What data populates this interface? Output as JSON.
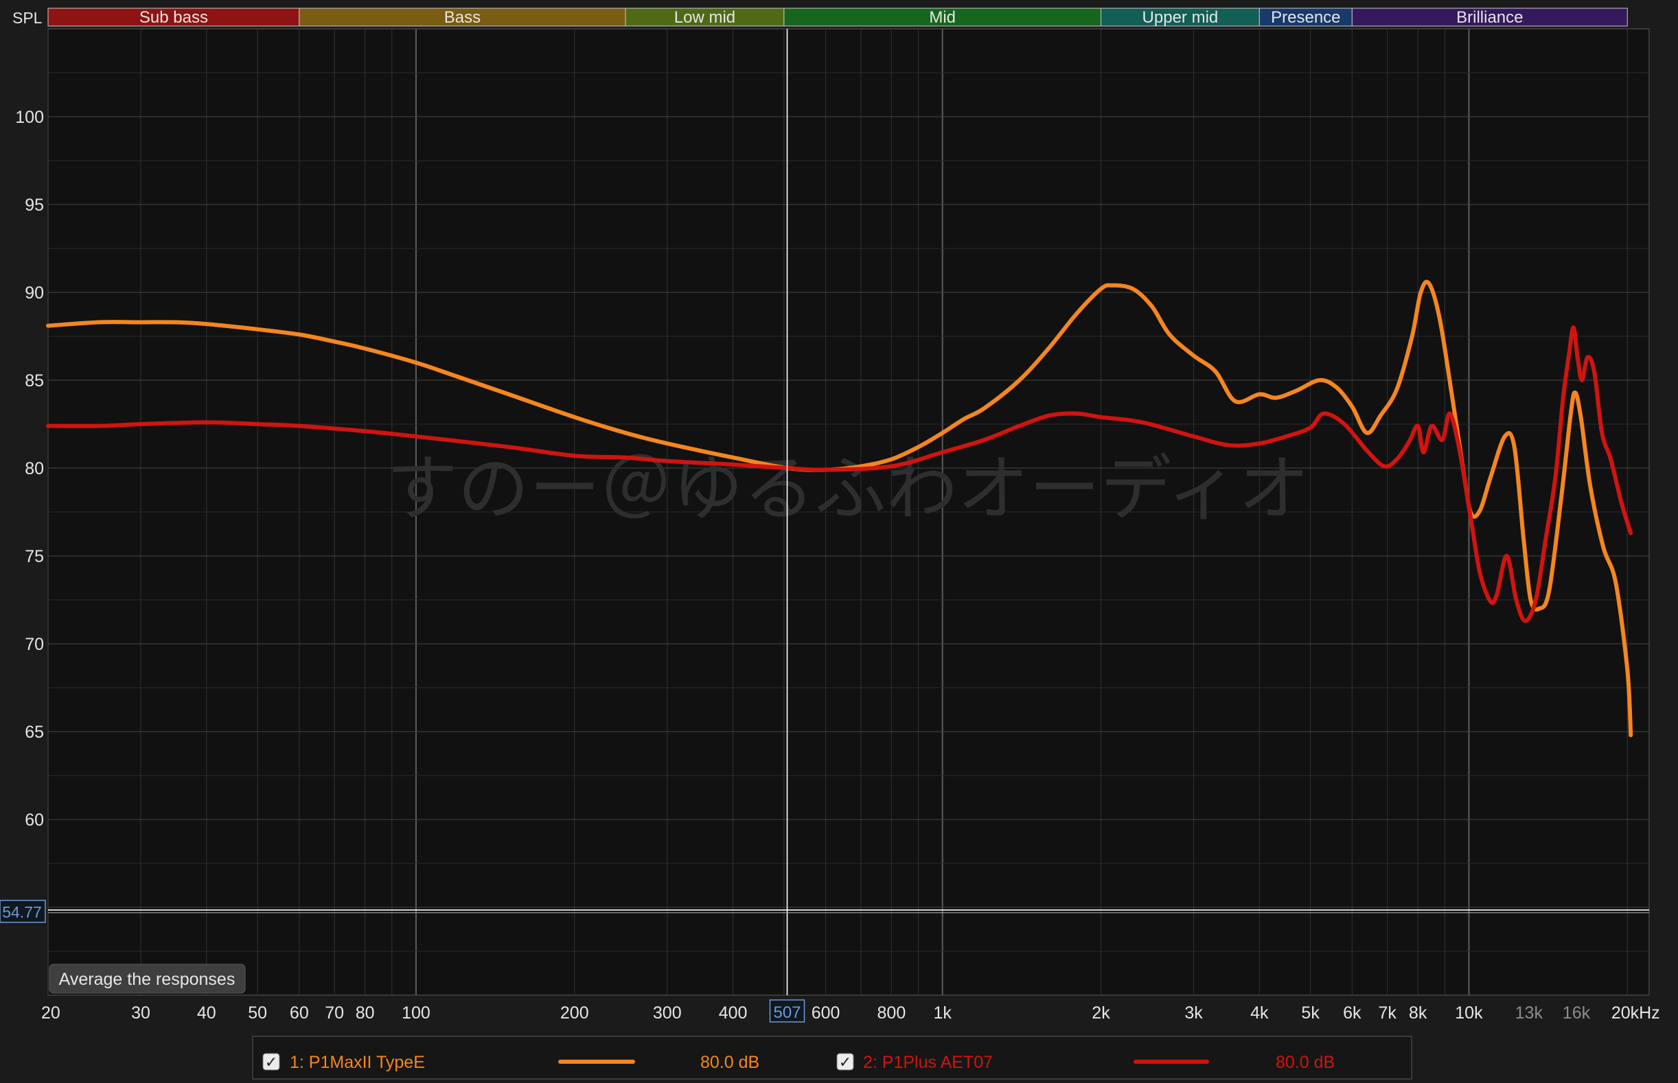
{
  "app": {
    "spl_label": "SPL",
    "cursor_freq_label": "507",
    "cursor_level_label": "54.77",
    "average_button_label": "Average the responses",
    "watermark": "すのー＠ゆるふわオーディオ"
  },
  "colors": {
    "background": "#1b1b1b",
    "plot_background": "#111111",
    "grid_major": "#555555",
    "grid_minor": "#333333",
    "axis_text": "#e6e6e6",
    "cursor": "#ffffff",
    "cursor_label": "#6a9bd8",
    "series_1": "#f5861f",
    "series_2": "#d0140f"
  },
  "chart_data": {
    "type": "line",
    "x_scale": "log",
    "xlim": [
      20,
      22000
    ],
    "ylim": [
      50,
      105
    ],
    "grid": true,
    "legend": "bottom",
    "x_ticks": [
      {
        "value": 20,
        "label": "20"
      },
      {
        "value": 30,
        "label": "30"
      },
      {
        "value": 40,
        "label": "40"
      },
      {
        "value": 50,
        "label": "50"
      },
      {
        "value": 60,
        "label": "60"
      },
      {
        "value": 70,
        "label": "70"
      },
      {
        "value": 80,
        "label": "80"
      },
      {
        "value": 100,
        "label": "100"
      },
      {
        "value": 200,
        "label": "200"
      },
      {
        "value": 300,
        "label": "300"
      },
      {
        "value": 400,
        "label": "400"
      },
      {
        "value": 600,
        "label": "600"
      },
      {
        "value": 800,
        "label": "800"
      },
      {
        "value": 1000,
        "label": "1k"
      },
      {
        "value": 2000,
        "label": "2k"
      },
      {
        "value": 3000,
        "label": "3k"
      },
      {
        "value": 4000,
        "label": "4k"
      },
      {
        "value": 5000,
        "label": "5k"
      },
      {
        "value": 6000,
        "label": "6k"
      },
      {
        "value": 7000,
        "label": "7k"
      },
      {
        "value": 8000,
        "label": "8k"
      },
      {
        "value": 10000,
        "label": "10k"
      },
      {
        "value": 13000,
        "label": "13k",
        "dim": true
      },
      {
        "value": 16000,
        "label": "16k",
        "dim": true
      },
      {
        "value": 20000,
        "label": "20kHz"
      }
    ],
    "y_ticks": [
      60,
      65,
      70,
      75,
      80,
      85,
      90,
      95,
      100
    ],
    "bands": [
      {
        "name": "Sub bass",
        "from": 20,
        "to": 60,
        "color": "#8e1414"
      },
      {
        "name": "Bass",
        "from": 60,
        "to": 250,
        "color": "#7a5c12"
      },
      {
        "name": "Low mid",
        "from": 250,
        "to": 500,
        "color": "#4f6a16"
      },
      {
        "name": "Mid",
        "from": 500,
        "to": 2000,
        "color": "#16661d"
      },
      {
        "name": "Upper mid",
        "from": 2000,
        "to": 4000,
        "color": "#135e55"
      },
      {
        "name": "Presence",
        "from": 4000,
        "to": 6000,
        "color": "#17396b"
      },
      {
        "name": "Brilliance",
        "from": 6000,
        "to": 20000,
        "color": "#341a5c"
      }
    ],
    "cursor": {
      "x": 507,
      "y": 54.77
    },
    "series": [
      {
        "name": "1: P1MaxII TypeE",
        "level": "80.0 dB",
        "color": "#f5861f",
        "points": [
          [
            20,
            88.1
          ],
          [
            25,
            88.3
          ],
          [
            30,
            88.3
          ],
          [
            35,
            88.3
          ],
          [
            40,
            88.2
          ],
          [
            50,
            87.9
          ],
          [
            60,
            87.6
          ],
          [
            70,
            87.2
          ],
          [
            80,
            86.8
          ],
          [
            100,
            86.0
          ],
          [
            120,
            85.2
          ],
          [
            150,
            84.2
          ],
          [
            200,
            82.9
          ],
          [
            250,
            82.0
          ],
          [
            300,
            81.4
          ],
          [
            400,
            80.6
          ],
          [
            507,
            80.0
          ],
          [
            600,
            79.9
          ],
          [
            700,
            80.1
          ],
          [
            800,
            80.5
          ],
          [
            900,
            81.2
          ],
          [
            1000,
            82.0
          ],
          [
            1100,
            82.8
          ],
          [
            1200,
            83.4
          ],
          [
            1400,
            85.0
          ],
          [
            1600,
            86.9
          ],
          [
            1800,
            88.8
          ],
          [
            2000,
            90.2
          ],
          [
            2100,
            90.4
          ],
          [
            2300,
            90.2
          ],
          [
            2500,
            89.2
          ],
          [
            2700,
            87.6
          ],
          [
            3000,
            86.4
          ],
          [
            3300,
            85.5
          ],
          [
            3600,
            83.8
          ],
          [
            4000,
            84.2
          ],
          [
            4300,
            84.0
          ],
          [
            4700,
            84.4
          ],
          [
            5200,
            85.0
          ],
          [
            5600,
            84.6
          ],
          [
            6000,
            83.5
          ],
          [
            6400,
            82.0
          ],
          [
            6800,
            83.0
          ],
          [
            7300,
            84.5
          ],
          [
            7800,
            87.5
          ],
          [
            8100,
            90.0
          ],
          [
            8400,
            90.5
          ],
          [
            8800,
            88.5
          ],
          [
            9300,
            84.0
          ],
          [
            9800,
            79.5
          ],
          [
            10100,
            77.4
          ],
          [
            10500,
            77.6
          ],
          [
            11000,
            79.5
          ],
          [
            11700,
            81.8
          ],
          [
            12200,
            81.2
          ],
          [
            12700,
            76.0
          ],
          [
            13100,
            72.5
          ],
          [
            13600,
            72.0
          ],
          [
            14200,
            73.0
          ],
          [
            15000,
            78.5
          ],
          [
            15600,
            83.0
          ],
          [
            15900,
            84.3
          ],
          [
            16300,
            83.0
          ],
          [
            17000,
            79.0
          ],
          [
            18000,
            75.5
          ],
          [
            19000,
            73.5
          ],
          [
            20000,
            68.5
          ],
          [
            20300,
            64.8
          ]
        ]
      },
      {
        "name": "2: P1Plus AET07",
        "level": "80.0 dB",
        "color": "#d0140f",
        "points": [
          [
            20,
            82.4
          ],
          [
            25,
            82.4
          ],
          [
            30,
            82.5
          ],
          [
            40,
            82.6
          ],
          [
            50,
            82.5
          ],
          [
            60,
            82.4
          ],
          [
            80,
            82.1
          ],
          [
            100,
            81.8
          ],
          [
            150,
            81.2
          ],
          [
            200,
            80.7
          ],
          [
            250,
            80.6
          ],
          [
            300,
            80.4
          ],
          [
            400,
            80.2
          ],
          [
            507,
            80.0
          ],
          [
            600,
            79.9
          ],
          [
            800,
            80.1
          ],
          [
            1000,
            80.9
          ],
          [
            1200,
            81.6
          ],
          [
            1400,
            82.4
          ],
          [
            1600,
            83.0
          ],
          [
            1800,
            83.1
          ],
          [
            2000,
            82.9
          ],
          [
            2400,
            82.6
          ],
          [
            3000,
            81.8
          ],
          [
            3500,
            81.3
          ],
          [
            4000,
            81.4
          ],
          [
            4500,
            81.8
          ],
          [
            5000,
            82.3
          ],
          [
            5300,
            83.1
          ],
          [
            5800,
            82.5
          ],
          [
            6400,
            81.0
          ],
          [
            6900,
            80.1
          ],
          [
            7300,
            80.5
          ],
          [
            7700,
            81.5
          ],
          [
            8000,
            82.4
          ],
          [
            8200,
            80.9
          ],
          [
            8500,
            82.4
          ],
          [
            8900,
            81.6
          ],
          [
            9200,
            83.1
          ],
          [
            9600,
            81.0
          ],
          [
            10100,
            77.0
          ],
          [
            10500,
            74.0
          ],
          [
            11000,
            72.4
          ],
          [
            11300,
            72.8
          ],
          [
            11800,
            75.0
          ],
          [
            12300,
            72.5
          ],
          [
            12800,
            71.3
          ],
          [
            13400,
            72.5
          ],
          [
            14000,
            76.0
          ],
          [
            14600,
            79.5
          ],
          [
            15100,
            84.0
          ],
          [
            15500,
            86.5
          ],
          [
            15800,
            88.0
          ],
          [
            16100,
            86.2
          ],
          [
            16400,
            85.0
          ],
          [
            16800,
            86.3
          ],
          [
            17300,
            85.5
          ],
          [
            17900,
            82.0
          ],
          [
            18600,
            80.5
          ],
          [
            19500,
            78.0
          ],
          [
            20300,
            76.3
          ]
        ]
      }
    ]
  }
}
